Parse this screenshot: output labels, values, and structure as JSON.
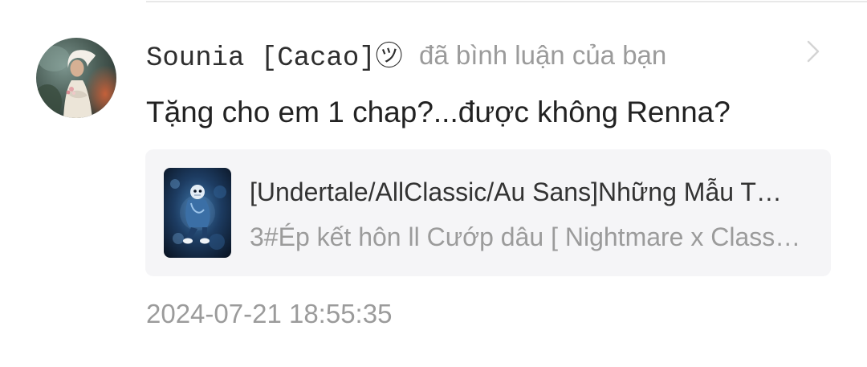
{
  "notification": {
    "username": "Sounia [Cacao]㋡",
    "action_text": "đã bình luận của bạn",
    "comment": "Tặng cho em 1 chap?...được không Renna?",
    "timestamp": "2024-07-21 18:55:35",
    "avatar_icon": "user-avatar-portrait",
    "chevron_icon": "chevron-right-icon"
  },
  "story_card": {
    "title": "[Undertale/AllClassic/Au Sans]Những Mẫu T…",
    "chapter": "3#Ép kết hôn ll Cướp dâu [ Nightmare x Class…",
    "cover_icon": "story-cover-image"
  },
  "colors": {
    "bg": "#ffffff",
    "divider": "#e8e8e8",
    "text-primary": "#222222",
    "text-name": "#2e2e2e",
    "text-title": "#333333",
    "text-secondary": "#9b9b9b",
    "card-bg": "#f5f5f7",
    "chevron": "#d4d4d4"
  }
}
